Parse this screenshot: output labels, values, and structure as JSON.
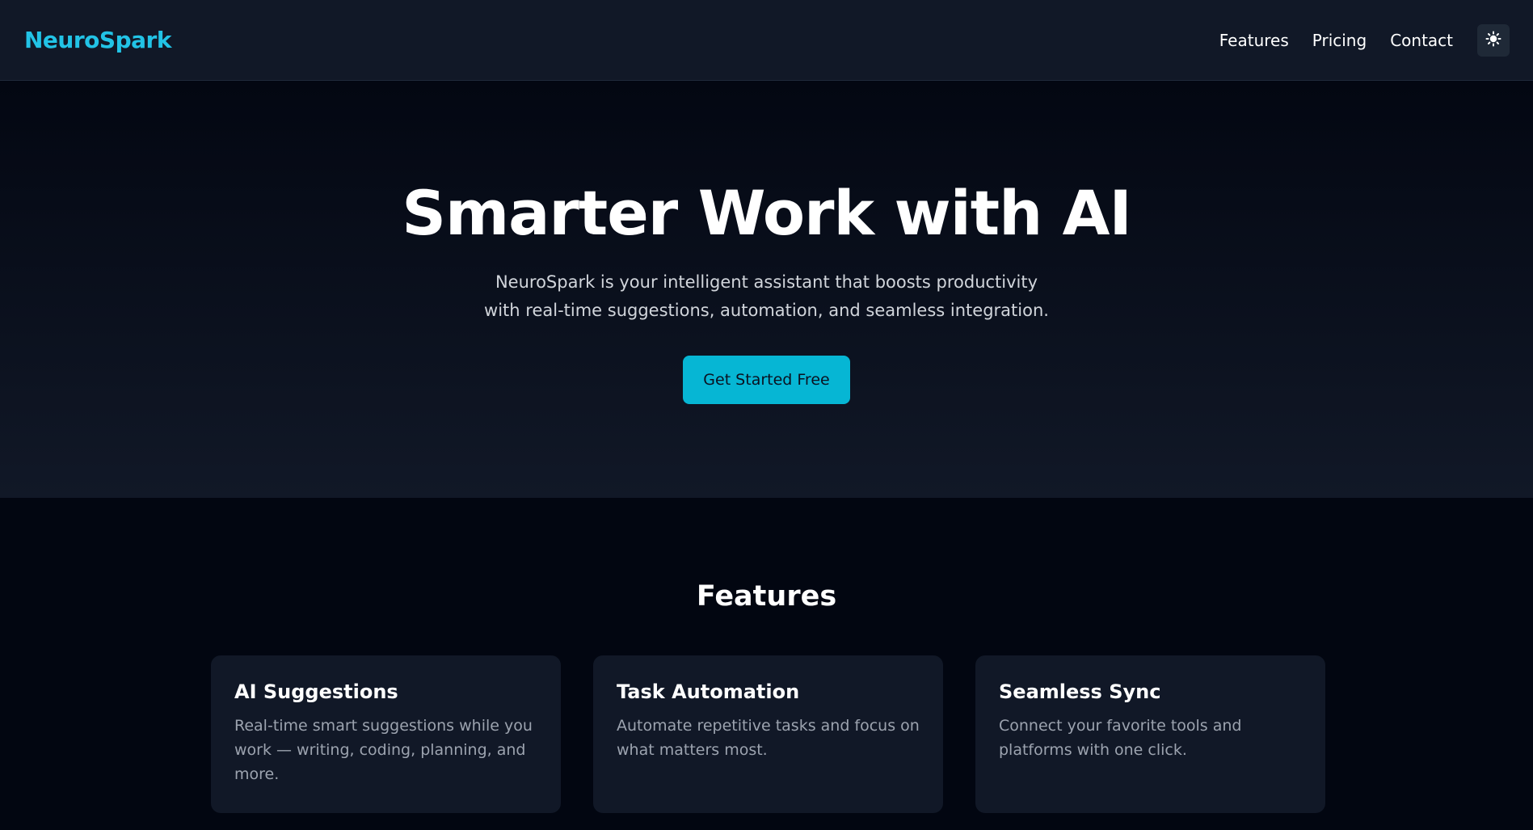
{
  "navbar": {
    "logo": "NeuroSpark",
    "links": [
      "Features",
      "Pricing",
      "Contact"
    ],
    "theme_toggle_icon": "sun-icon"
  },
  "hero": {
    "title": "Smarter Work with AI",
    "subtitle": "NeuroSpark is your intelligent assistant that boosts productivity with real-time suggestions, automation, and seamless integration.",
    "cta_label": "Get Started Free"
  },
  "features": {
    "heading": "Features",
    "cards": [
      {
        "title": "AI Suggestions",
        "description": "Real-time smart suggestions while you work — writing, coding, planning, and more."
      },
      {
        "title": "Task Automation",
        "description": "Automate repetitive tasks and focus on what matters most."
      },
      {
        "title": "Seamless Sync",
        "description": "Connect your favorite tools and platforms with one click."
      }
    ]
  },
  "colors": {
    "accent": "#06b6d4",
    "logo": "#22c3e6",
    "navbar_bg": "#111827",
    "page_bg": "#020611",
    "card_bg": "#111827",
    "muted_text": "#9ca3af"
  }
}
